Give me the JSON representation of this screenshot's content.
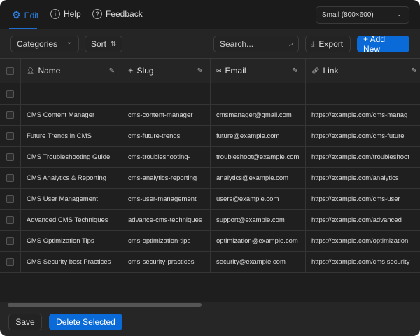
{
  "topbar": {
    "edit": "Edit",
    "help": "Help",
    "feedback": "Feedback",
    "size_select": "Small (800×600)"
  },
  "toolbar": {
    "categories": "Categories",
    "sort": "Sort",
    "search_placeholder": "Search...",
    "export": "Export",
    "add_new": "+ Add New"
  },
  "columns": [
    {
      "label": "Name",
      "icon": "user-icon"
    },
    {
      "label": "Slug",
      "icon": "asterisk-icon"
    },
    {
      "label": "Email",
      "icon": "mail-icon"
    },
    {
      "label": "Link",
      "icon": "link-icon"
    }
  ],
  "rows": [
    [
      "",
      "",
      "",
      ""
    ],
    [
      "CMS Content Manager",
      "cms-content-manager",
      "cmsmanager@gmail.com",
      "https://example.com/cms-manag"
    ],
    [
      "Future Trends in CMS",
      "cms-future-trends",
      "future@example.com",
      "https://example.com/cms-future"
    ],
    [
      "CMS Troubleshooting Guide",
      "cms-troubleshooting-",
      "troubleshoot@example.com",
      "https://example.com/troubleshoot"
    ],
    [
      "CMS Analytics & Reporting",
      "cms-analytics-reporting",
      "analytics@example.com",
      "https://example.com/analytics"
    ],
    [
      "CMS User Management",
      "cms-user-management",
      "users@example.com",
      "https://example.com/cms-user"
    ],
    [
      "Advanced CMS Techniques",
      "advance-cms-techniques",
      "support@example.com",
      "https://example.com/advanced"
    ],
    [
      "CMS Optimization Tips",
      "cms-optimization-tips",
      "optimization@example.com",
      "https://example.com/optimization"
    ],
    [
      "CMS Security best Practices",
      "cms-security-practices",
      "security@example.com",
      "https://example.com/cms security"
    ]
  ],
  "footer": {
    "save": "Save",
    "delete_selected": "Delete Selected"
  },
  "colors": {
    "accent": "#0a6ad8"
  }
}
